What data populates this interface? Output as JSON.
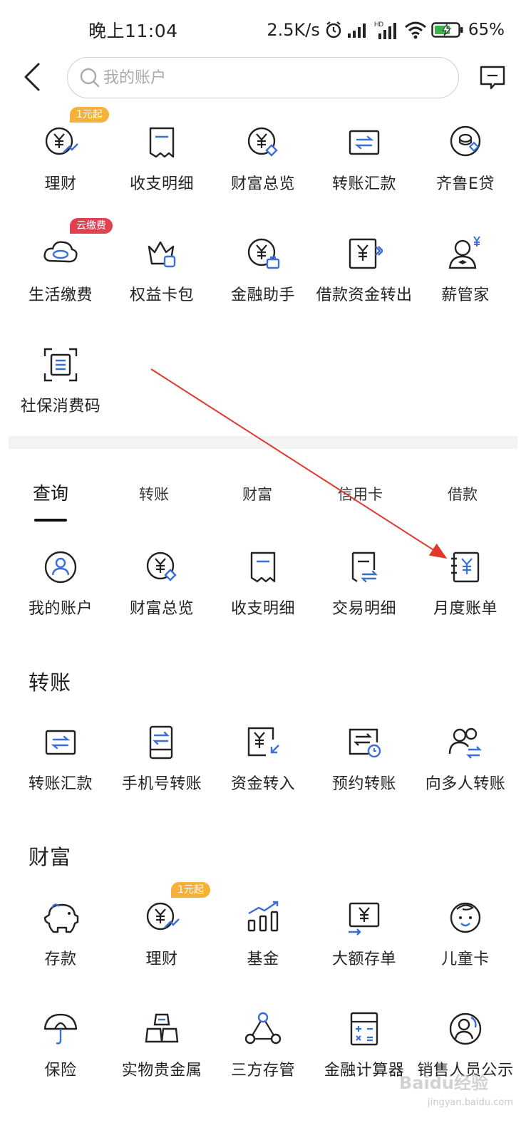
{
  "status_bar": {
    "time": "晚上11:04",
    "speed": "2.5K/s",
    "battery": "65%",
    "icons": [
      "alarm-icon",
      "signal-icon",
      "hd-signal-icon",
      "wifi-icon",
      "battery-charging-icon"
    ]
  },
  "header": {
    "search_placeholder": "我的账户",
    "back_icon": "chevron-left-icon",
    "message_icon": "message-icon"
  },
  "top_grid": [
    {
      "label": "理财",
      "icon": "yuan-chart-icon",
      "badge": "1元起",
      "badge_color": "#f5b23a"
    },
    {
      "label": "收支明细",
      "icon": "receipt-icon"
    },
    {
      "label": "财富总览",
      "icon": "yuan-diamond-icon"
    },
    {
      "label": "转账汇款",
      "icon": "transfer-icon"
    },
    {
      "label": "齐鲁E贷",
      "icon": "coin-stack-icon"
    },
    {
      "label": "生活缴费",
      "icon": "cloud-icon",
      "badge": "云缴费",
      "badge_color": "#e04050"
    },
    {
      "label": "权益卡包",
      "icon": "crown-card-icon"
    },
    {
      "label": "金融助手",
      "icon": "yuan-briefcase-icon"
    },
    {
      "label": "借款资金转出",
      "icon": "yuan-forward-icon"
    },
    {
      "label": "薪管家",
      "icon": "butler-icon"
    },
    {
      "label": "社保消费码",
      "icon": "scan-code-icon"
    }
  ],
  "tabs": [
    "查询",
    "转账",
    "财富",
    "信用卡",
    "借款"
  ],
  "query_grid": [
    {
      "label": "我的账户",
      "icon": "user-circle-icon"
    },
    {
      "label": "财富总览",
      "icon": "yuan-diamond-icon"
    },
    {
      "label": "收支明细",
      "icon": "receipt-icon"
    },
    {
      "label": "交易明细",
      "icon": "receipt-transfer-icon"
    },
    {
      "label": "月度账单",
      "icon": "yuan-notebook-icon"
    }
  ],
  "transfer_section": {
    "title": "转账",
    "items": [
      {
        "label": "转账汇款",
        "icon": "transfer-icon"
      },
      {
        "label": "手机号转账",
        "icon": "phone-transfer-icon"
      },
      {
        "label": "资金转入",
        "icon": "yuan-in-icon"
      },
      {
        "label": "预约转账",
        "icon": "scheduled-transfer-icon"
      },
      {
        "label": "向多人转账",
        "icon": "multi-user-transfer-icon"
      }
    ]
  },
  "wealth_section": {
    "title": "财富",
    "items": [
      {
        "label": "存款",
        "icon": "piggy-bank-icon"
      },
      {
        "label": "理财",
        "icon": "yuan-chart-icon",
        "badge": "1元起",
        "badge_color": "#f5b23a"
      },
      {
        "label": "基金",
        "icon": "bar-chart-icon"
      },
      {
        "label": "大额存单",
        "icon": "yuan-certificate-icon"
      },
      {
        "label": "儿童卡",
        "icon": "child-face-icon"
      },
      {
        "label": "保险",
        "icon": "umbrella-icon"
      },
      {
        "label": "实物贵金属",
        "icon": "gold-bars-icon"
      },
      {
        "label": "三方存管",
        "icon": "triangle-nodes-icon"
      },
      {
        "label": "金融计算器",
        "icon": "calculator-icon"
      },
      {
        "label": "销售人员公示",
        "icon": "staff-icon"
      }
    ]
  },
  "colors": {
    "icon_stroke": "#222222",
    "icon_accent": "#3a6fd8",
    "arrow": "#e0392b"
  },
  "watermark": {
    "main": "Baidu经验",
    "sub": "jingyan.baidu.com"
  }
}
